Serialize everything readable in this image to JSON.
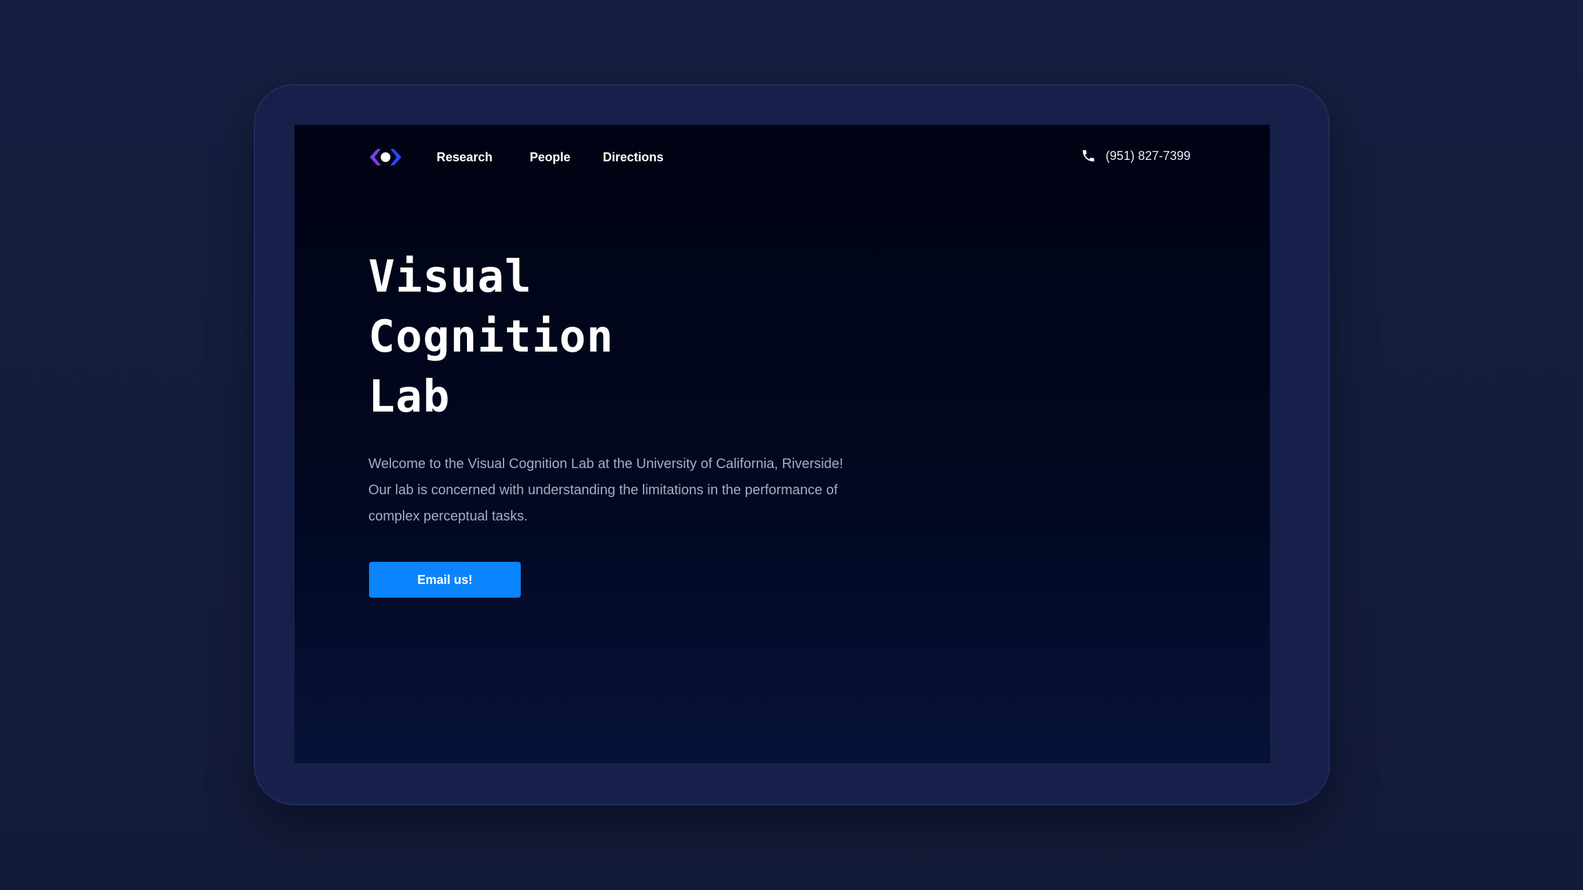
{
  "nav": {
    "logo_icon": "eye-logo-icon",
    "links": [
      {
        "label": "Research"
      },
      {
        "label": "People"
      },
      {
        "label": "Directions"
      }
    ],
    "phone_icon": "phone-icon",
    "phone": "(951) 827-7399"
  },
  "hero": {
    "title_lines": [
      "Visual",
      "Cognition",
      "Lab"
    ],
    "description": "Welcome to the Visual Cognition Lab at the University of California, Riverside! Our lab is concerned with understanding the limitations in the performance of complex perceptual tasks.",
    "cta_label": "Email us!"
  },
  "colors": {
    "page_background": "#151d3d",
    "device_frame": "#16204a",
    "screen_background": "#000313",
    "accent_button": "#0a84ff",
    "logo_purple": "#7b3fe4",
    "logo_blue": "#2b44ff",
    "body_text": "#a7adc1"
  }
}
